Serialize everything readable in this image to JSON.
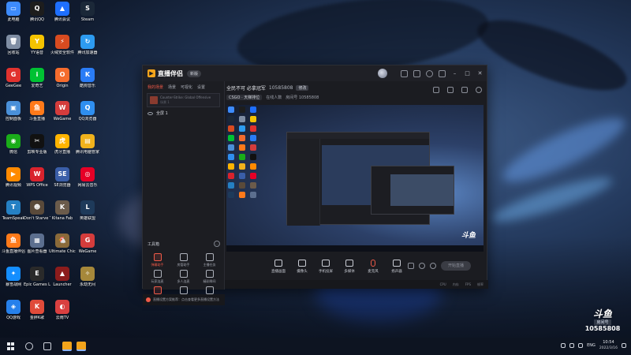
{
  "colors": {
    "accent": "#f05a48",
    "brand": "#f3a41b",
    "window_bg": "#1b1c21"
  },
  "desktop": {
    "icons": [
      {
        "label": "此电脑",
        "icon": "computer-icon",
        "color": "#3d8bfd",
        "glyph": "▭"
      },
      {
        "label": "腾讯QQ",
        "icon": "qq-icon",
        "color": "#1d1d1d",
        "glyph": "Q"
      },
      {
        "label": "腾讯会议",
        "icon": "meeting-icon",
        "color": "#1e6fff",
        "glyph": "▲"
      },
      {
        "label": "Steam",
        "icon": "steam-icon",
        "color": "#1b2838",
        "glyph": "S"
      },
      {
        "label": "回收站",
        "icon": "recycle-bin-icon",
        "color": "#7f8da3",
        "glyph": "🗑"
      },
      {
        "label": "YY语音",
        "icon": "yy-icon",
        "color": "#f5c400",
        "glyph": "Y"
      },
      {
        "label": "火绒安全软件",
        "icon": "huorong-icon",
        "color": "#d84b20",
        "glyph": "⚡"
      },
      {
        "label": "腾讯加速器",
        "icon": "accelerator-icon",
        "color": "#2d9bf0",
        "glyph": "↻"
      },
      {
        "label": "GeeGee",
        "icon": "geegee-icon",
        "color": "#e1322e",
        "glyph": "G"
      },
      {
        "label": "爱奇艺",
        "icon": "iqiyi-icon",
        "color": "#00c233",
        "glyph": "i"
      },
      {
        "label": "Origin",
        "icon": "origin-icon",
        "color": "#f56c2d",
        "glyph": "O"
      },
      {
        "label": "酷狗音乐",
        "icon": "kugou-icon",
        "color": "#2a7cf6",
        "glyph": "K"
      },
      {
        "label": "控制面板",
        "icon": "control-panel-icon",
        "color": "#4a90d9",
        "glyph": "▣"
      },
      {
        "label": "斗鱼直播",
        "icon": "douyu-icon",
        "color": "#ff7a1a",
        "glyph": "鱼"
      },
      {
        "label": "WeGame",
        "icon": "wegame-icon",
        "color": "#d43c3c",
        "glyph": "W"
      },
      {
        "label": "QQ浏览器",
        "icon": "qq-browser-icon",
        "color": "#2f8ff0",
        "glyph": "Q"
      },
      {
        "label": "微信",
        "icon": "wechat-icon",
        "color": "#1aad19",
        "glyph": "◉"
      },
      {
        "label": "剪映专业版",
        "icon": "capcut-icon",
        "color": "#111111",
        "glyph": "✂"
      },
      {
        "label": "虎牙直播",
        "icon": "huya-icon",
        "color": "#ffb400",
        "glyph": "虎"
      },
      {
        "label": "腾讯电脑管家",
        "icon": "pc-manager-icon",
        "color": "#f0b21c",
        "glyph": "▤"
      },
      {
        "label": "腾讯视频",
        "icon": "tencent-video-icon",
        "color": "#ff8a00",
        "glyph": "▶"
      },
      {
        "label": "WPS Office",
        "icon": "wps-icon",
        "color": "#d9232d",
        "glyph": "W"
      },
      {
        "label": "SE浏览器",
        "icon": "se-icon",
        "color": "#3a5ea8",
        "glyph": "SE"
      },
      {
        "label": "网易云音乐",
        "icon": "netease-music-icon",
        "color": "#e60026",
        "glyph": "◎"
      },
      {
        "label": "TeamSpeak",
        "icon": "teamspeak-icon",
        "color": "#2580c3",
        "glyph": "T"
      },
      {
        "label": "Don't Starve Together",
        "icon": "dont-starve-icon",
        "color": "#5a4a3a",
        "glyph": "☻"
      },
      {
        "label": "Kitana Fab",
        "icon": "kitana-icon",
        "color": "#6b5b4b",
        "glyph": "K"
      },
      {
        "label": "英雄联盟",
        "icon": "lol-icon",
        "color": "#1e3a5a",
        "glyph": "L"
      },
      {
        "label": "斗鱼直播伴侣",
        "icon": "douyu-companion-icon",
        "color": "#ff7a1a",
        "glyph": "鱼"
      },
      {
        "label": "图片查看器",
        "icon": "image-viewer-icon",
        "color": "#5c6f8f",
        "glyph": "▦"
      },
      {
        "label": "Ultimate Chicken",
        "icon": "chicken-icon",
        "color": "#8a6a3a",
        "glyph": "🐔"
      },
      {
        "label": "WeGame",
        "icon": "wegame2-icon",
        "color": "#d43c3c",
        "glyph": "G"
      },
      {
        "label": "暴雪战网",
        "icon": "battlenet-icon",
        "color": "#148eff",
        "glyph": "✦"
      },
      {
        "label": "Epic Games Launcher",
        "icon": "epic-icon",
        "color": "#2a2a2a",
        "glyph": "E"
      },
      {
        "label": "Launcher",
        "icon": "launcher-icon",
        "color": "#8c1c1c",
        "glyph": "▲"
      },
      {
        "label": "永劫无间",
        "icon": "naraka-icon",
        "color": "#a6883a",
        "glyph": "✧"
      },
      {
        "label": "QQ游戏",
        "icon": "qq-game-icon",
        "color": "#2680eb",
        "glyph": "◈"
      },
      {
        "label": "金胖K歌",
        "icon": "karaoke-icon",
        "color": "#e04b3a",
        "glyph": "K"
      },
      {
        "label": "云雨TV",
        "icon": "yunyu-tv-icon",
        "color": "#d94040",
        "glyph": "◐"
      }
    ]
  },
  "app": {
    "title": "直播伴侣",
    "version": "新版",
    "left_tabs": [
      "我的场景",
      "场景",
      "可视化",
      "设置"
    ],
    "scene_text1": "Counter-Strike: Global Offensive",
    "scene_text2": "场景 1",
    "source_label": "全屏 1",
    "toolbox_title": "工具箱",
    "tools": [
      {
        "label": "弹幕助手",
        "icon": "danmaku-icon",
        "hot": true
      },
      {
        "label": "房管助手",
        "icon": "admin-icon",
        "hot": false
      },
      {
        "label": "主播任务",
        "icon": "task-icon",
        "hot": false
      },
      {
        "label": "玩家连麦",
        "icon": "link-mic-icon",
        "hot": false
      },
      {
        "label": "多人连麦",
        "icon": "multi-mic-icon",
        "hot": false
      },
      {
        "label": "精彩瞬间",
        "icon": "highlight-icon",
        "hot": false
      },
      {
        "label": "直播间",
        "icon": "room-icon",
        "hot": true
      },
      {
        "label": "直播切片",
        "icon": "clip-icon",
        "hot": false
      },
      {
        "label": "直播看板",
        "icon": "board-icon",
        "hot": false
      }
    ],
    "notice": "直播设置方案推荐：点击查看更多直播设置方法",
    "stream": {
      "title": "全民不可 必拿冠军",
      "room": "10585808",
      "edit": "修改",
      "category": "CSGO · 天梯排位",
      "online": "在线人数",
      "room_label": "房间号 10585808"
    },
    "controls": [
      {
        "label": "直播画面",
        "icon": "screen-icon"
      },
      {
        "label": "摄像头",
        "icon": "camera-icon"
      },
      {
        "label": "手机投屏",
        "icon": "phone-cast-icon"
      },
      {
        "label": "多媒体",
        "icon": "media-icon"
      },
      {
        "label": "麦克风",
        "icon": "mic-icon"
      },
      {
        "label": "扬声器",
        "icon": "speaker-icon"
      }
    ],
    "start_label": "开始直播",
    "status": [
      "CPU",
      "内存",
      "FPS",
      "帧率"
    ]
  },
  "douyu_badge": {
    "logo": "斗鱼",
    "room_label": "房间号",
    "room": "10585808"
  },
  "taskbar": {
    "lang": "ENG",
    "time": "10:54",
    "date": "2022/3/16"
  }
}
